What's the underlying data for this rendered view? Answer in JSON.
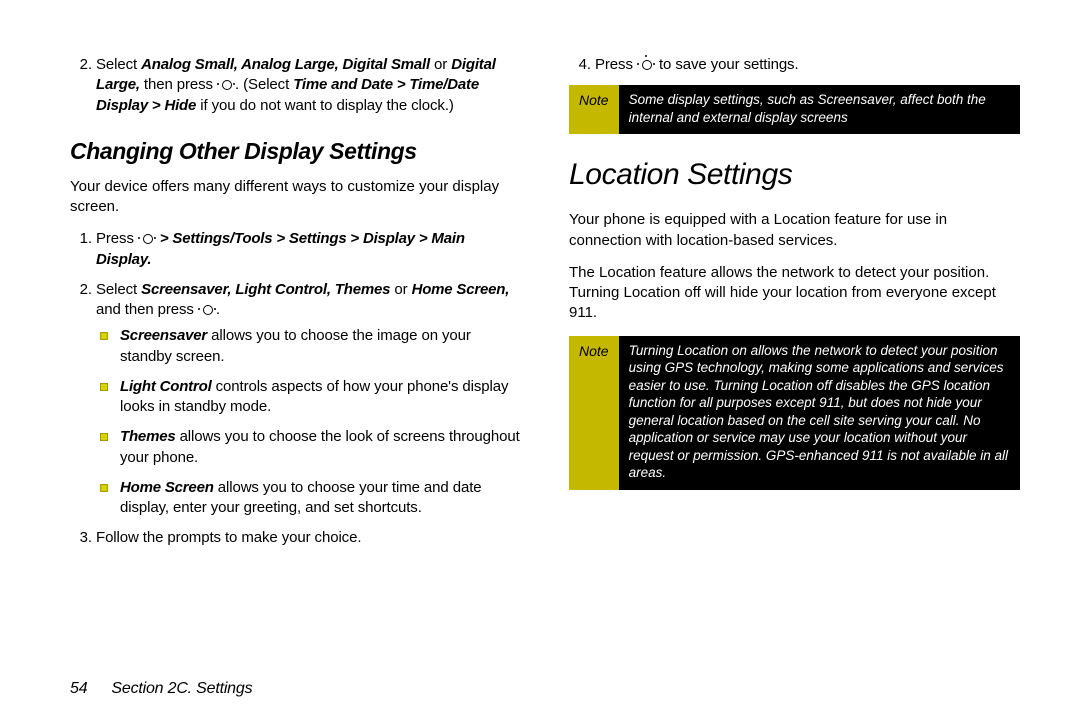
{
  "left": {
    "continued_step_num": "2.",
    "continued_step_pre": "Select ",
    "continued_step_bold1": "Analog Small, Analog Large, Digital Small",
    "continued_step_mid": " or ",
    "continued_step_bold2": "Digital Large,",
    "continued_step_after_bold2": " then press ",
    "continued_step_period": ". (Select ",
    "continued_step_bold3": "Time and Date > Time/Date Display > Hide",
    "continued_step_tail": " if you do not want to display the clock.)",
    "subsection": "Changing Other Display Settings",
    "intro": "Your device offers many different ways to customize your display screen.",
    "s1_pre": "Press ",
    "s1_bold": " > Settings/Tools > Settings > Display > Main Display.",
    "s2_pre": "Select ",
    "s2_bold1": "Screensaver, Light Control, Themes",
    "s2_mid": " or ",
    "s2_bold2": "Home Screen,",
    "s2_after": " and then press ",
    "s2_end": ".",
    "b1_bold": "Screensaver",
    "b1_tail": " allows you to choose the image on your standby screen.",
    "b2_bold": "Light Control",
    "b2_tail": " controls aspects of how your phone's display looks in standby mode.",
    "b3_bold": "Themes",
    "b3_tail": " allows you to choose the look of screens throughout your phone.",
    "b4_bold": "Home Screen",
    "b4_tail": " allows you to choose your time and date display, enter your greeting, and set shortcuts.",
    "s3": "Follow the prompts to make your choice."
  },
  "right": {
    "s4_pre": "Press ",
    "s4_tail": " to save your settings.",
    "note1_label": "Note",
    "note1_text": "Some display settings, such as Screensaver, affect both the internal and external display screens",
    "section": "Location Settings",
    "p1": "Your phone is equipped with a Location feature for use in connection with location-based services.",
    "p2": "The Location feature allows the network to detect your position. Turning Location off will hide your location from everyone except 911.",
    "note2_label": "Note",
    "note2_text": "Turning Location on allows the network to detect your position using GPS technology, making some applications and services easier to use. Turning Location off disables the GPS location function for all purposes except 911, but does not hide your general location based on the cell site serving your call. No application or service may use your location without your request or permission. GPS-enhanced 911 is not available in all areas."
  },
  "footer": {
    "page": "54",
    "section": "Section 2C. Settings"
  }
}
